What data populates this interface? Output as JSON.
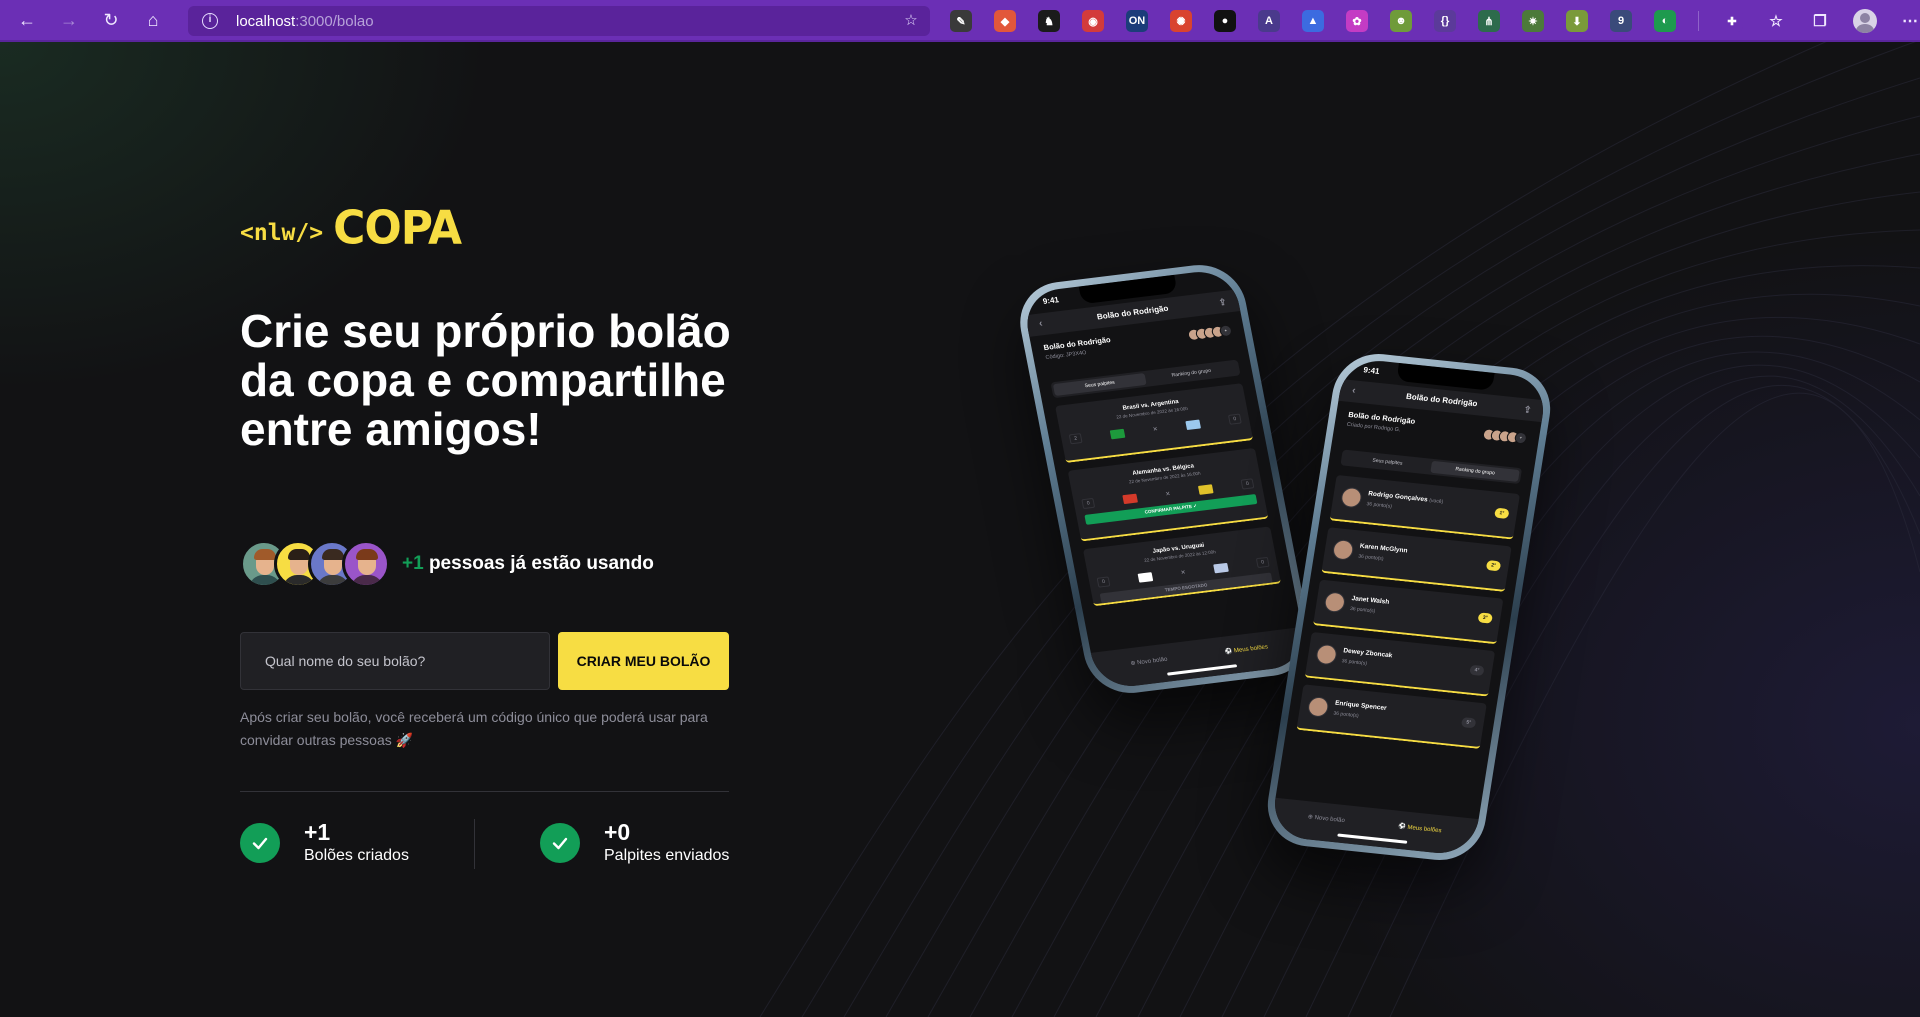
{
  "browser": {
    "url_host": "localhost",
    "url_path": ":3000/bolao",
    "extensions": [
      {
        "name": "eyedropper-icon",
        "color": "#3a3a3a",
        "glyph": "✎"
      },
      {
        "name": "fox-icon",
        "color": "#e2573a",
        "glyph": "◆"
      },
      {
        "name": "paw-icon",
        "color": "#1b1b1b",
        "glyph": "♞"
      },
      {
        "name": "react-devtools-icon",
        "color": "#d33b3b",
        "glyph": "◉"
      },
      {
        "name": "on-toggle-icon",
        "color": "#1c3d7a",
        "glyph": "ON"
      },
      {
        "name": "bug-icon",
        "color": "#d9432f",
        "glyph": "✺"
      },
      {
        "name": "record-icon",
        "color": "#111111",
        "glyph": "●"
      },
      {
        "name": "a-circle-icon",
        "color": "#4a3a8c",
        "glyph": "A"
      },
      {
        "name": "vue-devtools-icon",
        "color": "#3c6be0",
        "glyph": "▲"
      },
      {
        "name": "flower-icon",
        "color": "#c43cc4",
        "glyph": "✿"
      },
      {
        "name": "frog-icon",
        "color": "#6f9b3a",
        "glyph": "☻"
      },
      {
        "name": "json-icon",
        "color": "#5b3a9a",
        "glyph": "{}"
      },
      {
        "name": "graph-icon",
        "color": "#2d6b4c",
        "glyph": "⋔"
      },
      {
        "name": "gear-plugin-icon",
        "color": "#4c7a3a",
        "glyph": "✷"
      },
      {
        "name": "download-arrow-icon",
        "color": "#7a9a3a",
        "glyph": "⬇"
      },
      {
        "name": "badge-nine-icon",
        "color": "#3a4a7a",
        "glyph": "9"
      },
      {
        "name": "colorful-circle-icon",
        "color": "#1e9a4e",
        "glyph": "◐"
      },
      {
        "name": "puzzle-icon",
        "color": "#6b2fb5",
        "glyph": "✚"
      }
    ]
  },
  "logo": {
    "code_text": "<nlw/>",
    "word": "COPA"
  },
  "hero": {
    "headline": "Crie seu próprio bolão da copa e compartilhe entre amigos!"
  },
  "users_row": {
    "count": "+1",
    "text": "pessoas já estão usando",
    "avatars": [
      {
        "bg": "#6a9a8a",
        "hair": "#a05a2a",
        "shirt": "#2f4f4f"
      },
      {
        "bg": "#f7dd43",
        "hair": "#2a1f17",
        "shirt": "#2a2a2a"
      },
      {
        "bg": "#6a78c9",
        "hair": "#3a2a20",
        "shirt": "#3c3c3c"
      },
      {
        "bg": "#9a55c9",
        "hair": "#7a3a1a",
        "shirt": "#4a2a4a"
      }
    ]
  },
  "form": {
    "placeholder": "Qual nome do seu bolão?",
    "button_label": "CRIAR MEU BOLÃO"
  },
  "note": "Após criar seu bolão, você receberá um código único que poderá usar para convidar outras pessoas 🚀",
  "stats": [
    {
      "value": "+1",
      "label": "Bolões criados"
    },
    {
      "value": "+0",
      "label": "Palpites enviados"
    }
  ],
  "phone_left": {
    "time": "9:41",
    "header": "Bolão do Rodrigão",
    "pool_title": "Bolão do Rodrigão",
    "pool_code": "Código: JP3X4O",
    "tabs": [
      "Seus palpites",
      "Ranking do grupo"
    ],
    "games": [
      {
        "title": "Brasil vs. Argentina",
        "date": "22 de Novembro de 2022 às 16:00h",
        "home": "2",
        "away": "0",
        "f1": "#1d9a3c",
        "f2": "#9bc9ee"
      },
      {
        "title": "Alemanha vs. Bélgica",
        "date": "22 de Novembro de 2022 às 16:00h",
        "home": "0",
        "away": "0",
        "f1": "#d43a2a",
        "f2": "#e0c22a",
        "confirm": "CONFIRMAR PALPITE ✓"
      },
      {
        "title": "Japão vs. Uruguai",
        "date": "22 de Novembro de 2022 às 12:00h",
        "home": "0",
        "away": "0",
        "f1": "#ffffff",
        "f2": "#b9c9e6",
        "expired": "TEMPO ESGOTADO"
      }
    ],
    "tab_new": "Novo bolão",
    "tab_mine": "Meus bolões"
  },
  "phone_right": {
    "time": "9:41",
    "header": "Bolão do Rodrigão",
    "pool_title": "Bolão do Rodrigão",
    "pool_sub": "Criado por Rodrigo G.",
    "tabs": [
      "Seus palpites",
      "Ranking do grupo"
    ],
    "ranking": [
      {
        "name": "Rodrigo Gonçalves",
        "you": "(você)",
        "points": "36 ponto(s)",
        "rank": "1°",
        "top": true
      },
      {
        "name": "Karen McGlynn",
        "you": "",
        "points": "36 ponto(s)",
        "rank": "2°",
        "top": true
      },
      {
        "name": "Janet Walsh",
        "you": "",
        "points": "36 ponto(s)",
        "rank": "3°",
        "top": true
      },
      {
        "name": "Dewey Zboncak",
        "you": "",
        "points": "36 ponto(s)",
        "rank": "4°",
        "top": false
      },
      {
        "name": "Enrique Spencer",
        "you": "",
        "points": "36 ponto(s)",
        "rank": "5°",
        "top": false
      }
    ],
    "tab_new": "Novo bolão",
    "tab_mine": "Meus bolões"
  }
}
